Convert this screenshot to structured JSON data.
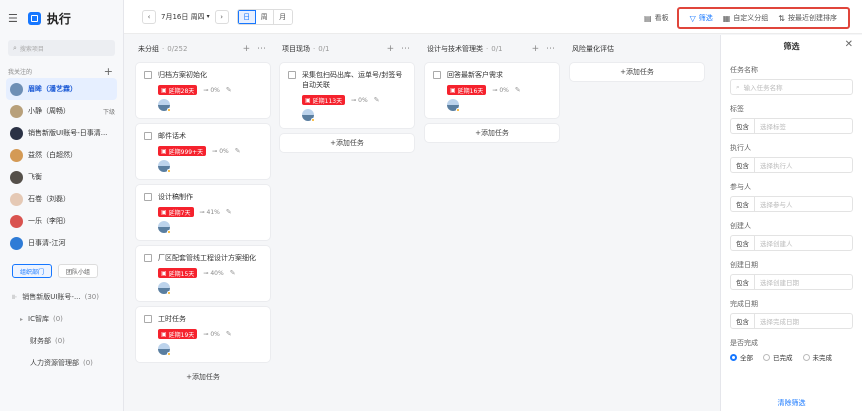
{
  "app": {
    "title": "执行"
  },
  "sidebar": {
    "search_placeholder": "搜索项目",
    "section_label": "我关注的",
    "items": [
      {
        "label": "眉眸（潘艺霖）",
        "extra": "",
        "color": "#6e8fb5",
        "active": true
      },
      {
        "label": "小静（周畅）",
        "extra": "下级",
        "color": "#b8a07a",
        "active": false
      },
      {
        "label": "销售新版UI账号-日事清...",
        "extra": "",
        "color": "#2b3245",
        "active": false
      },
      {
        "label": "益然（白超然）",
        "extra": "",
        "color": "#d49a55",
        "active": false
      },
      {
        "label": "飞衡",
        "extra": "",
        "color": "#55504a",
        "active": false
      },
      {
        "label": "石卷（刘磊）",
        "extra": "",
        "color": "#e5c9b5",
        "active": false
      },
      {
        "label": "一乐（李阳）",
        "extra": "",
        "color": "#d9534f",
        "active": false
      },
      {
        "label": "日事清-江河",
        "extra": "",
        "color": "#2e7bd6",
        "active": false
      }
    ],
    "tabs": [
      "组织部门",
      "团队小组"
    ],
    "org": [
      {
        "label": "销售新版UI账号-...",
        "count": "(30)",
        "level": 0,
        "caret": ""
      },
      {
        "label": "IC智库",
        "count": "(0)",
        "level": 1,
        "caret": "▸"
      },
      {
        "label": "财务部",
        "count": "(0)",
        "level": 2,
        "caret": ""
      },
      {
        "label": "人力资源管理部",
        "count": "(0)",
        "level": 2,
        "caret": ""
      }
    ]
  },
  "toolbar": {
    "date": "7月16日 周四",
    "views": [
      "日",
      "周",
      "月"
    ],
    "board_label": "看板",
    "filter_label": "筛选",
    "group_label": "自定义分组",
    "sort_label": "按最近创建排序"
  },
  "columns": [
    {
      "title": "未分组",
      "count": "0/252",
      "cards": [
        {
          "title": "归档方案初始化",
          "badge": "延期28天",
          "progress": "0%"
        },
        {
          "title": "邮件话术",
          "badge": "延期999+天",
          "progress": "0%"
        },
        {
          "title": "设计稿制作",
          "badge": "延期7天",
          "progress": "41%"
        },
        {
          "title": "厂区配套管线工程设计方案细化",
          "badge": "延期15天",
          "progress": "40%"
        },
        {
          "title": "工时任务",
          "badge": "延期19天",
          "progress": "0%"
        }
      ],
      "add_label": "添加任务"
    },
    {
      "title": "项目现场",
      "count": "0/1",
      "cards": [
        {
          "title": "采集包扫码出库、运单号/封签号自动关联",
          "badge": "延期113天",
          "progress": "0%"
        }
      ],
      "add_label": "添加任务"
    },
    {
      "title": "设计与技术管理类",
      "count": "0/1",
      "cards": [
        {
          "title": "回答最新客户需求",
          "badge": "延期16天",
          "progress": "0%"
        }
      ],
      "add_label": "添加任务"
    },
    {
      "title": "风险量化评估",
      "count": "",
      "cards": [],
      "add_label": "添加任务"
    }
  ],
  "filter": {
    "title": "筛选",
    "task_name_label": "任务名称",
    "task_name_placeholder": "输入任务名称",
    "fields": [
      {
        "label": "标签",
        "prefix": "包含",
        "placeholder": "选择标签"
      },
      {
        "label": "执行人",
        "prefix": "包含",
        "placeholder": "选择执行人"
      },
      {
        "label": "参与人",
        "prefix": "包含",
        "placeholder": "选择参与人"
      },
      {
        "label": "创建人",
        "prefix": "包含",
        "placeholder": "选择创建人"
      },
      {
        "label": "创建日期",
        "prefix": "包含",
        "placeholder": "选择创建日期"
      },
      {
        "label": "完成日期",
        "prefix": "包含",
        "placeholder": "选择完成日期"
      }
    ],
    "done_label": "是否完成",
    "done_options": [
      "全部",
      "已完成",
      "未完成"
    ],
    "done_selected": "全部",
    "clear_label": "清除筛选"
  }
}
